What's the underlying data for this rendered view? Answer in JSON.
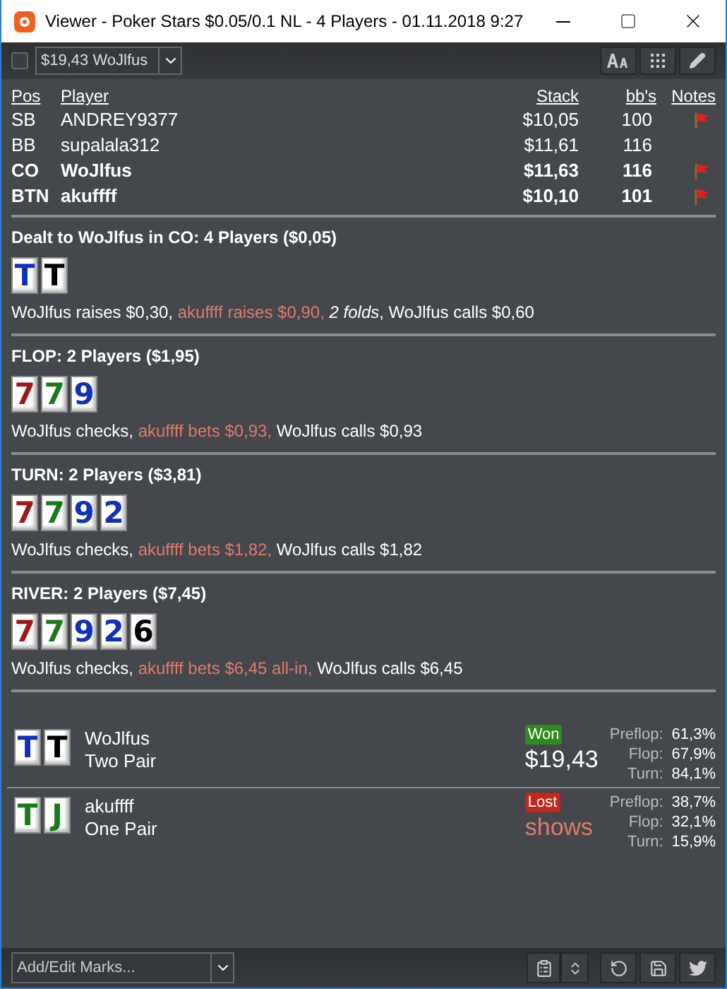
{
  "window": {
    "title": "Viewer - Poker Stars $0.05/0.1 NL - 4 Players - 01.11.2018 9:27"
  },
  "toolbar": {
    "checked": false,
    "hand_select": "$19,43 WoJlfus"
  },
  "players": {
    "columns": [
      "Pos",
      "Player",
      "Stack",
      "bb's",
      "Notes"
    ],
    "rows": [
      {
        "pos": "SB",
        "player": "ANDREY9377",
        "stack": "$10,05",
        "bbs": "100",
        "bold": false,
        "note": true
      },
      {
        "pos": "BB",
        "player": "supalala312",
        "stack": "$11,61",
        "bbs": "116",
        "bold": false,
        "note": false
      },
      {
        "pos": "CO",
        "player": "WoJlfus",
        "stack": "$11,63",
        "bbs": "116",
        "bold": true,
        "note": true
      },
      {
        "pos": "BTN",
        "player": "akuffff",
        "stack": "$10,10",
        "bbs": "101",
        "bold": true,
        "note": true
      }
    ]
  },
  "streets": [
    {
      "title": "Dealt to WoJlfus in CO: 4 Players ($0,05)",
      "cards": [
        {
          "rank": "T",
          "color": "#1030b8"
        },
        {
          "rank": "T",
          "color": "#000000"
        }
      ],
      "actions": [
        {
          "text": "WoJlfus raises $0,30, ",
          "kind": "hero"
        },
        {
          "text": "akuffff raises $0,90, ",
          "kind": "villain"
        },
        {
          "text": "2 folds",
          "kind": "fold"
        },
        {
          "text": ", WoJlfus calls $0,60",
          "kind": "hero"
        }
      ]
    },
    {
      "title": "FLOP: 2 Players ($1,95)",
      "cards": [
        {
          "rank": "7",
          "color": "#a01818"
        },
        {
          "rank": "7",
          "color": "#1a7a1a"
        },
        {
          "rank": "9",
          "color": "#1030b8"
        }
      ],
      "actions": [
        {
          "text": "WoJlfus checks, ",
          "kind": "hero"
        },
        {
          "text": "akuffff bets $0,93, ",
          "kind": "villain"
        },
        {
          "text": "WoJlfus calls $0,93",
          "kind": "hero"
        }
      ]
    },
    {
      "title": "TURN: 2 Players ($3,81)",
      "cards": [
        {
          "rank": "7",
          "color": "#a01818"
        },
        {
          "rank": "7",
          "color": "#1a7a1a"
        },
        {
          "rank": "9",
          "color": "#1030b8"
        },
        {
          "rank": "2",
          "color": "#1030b8"
        }
      ],
      "actions": [
        {
          "text": "WoJlfus checks, ",
          "kind": "hero"
        },
        {
          "text": "akuffff bets $1,82, ",
          "kind": "villain"
        },
        {
          "text": "WoJlfus calls $1,82",
          "kind": "hero"
        }
      ]
    },
    {
      "title": "RIVER: 2 Players ($7,45)",
      "cards": [
        {
          "rank": "7",
          "color": "#a01818"
        },
        {
          "rank": "7",
          "color": "#1a7a1a"
        },
        {
          "rank": "9",
          "color": "#1030b8"
        },
        {
          "rank": "2",
          "color": "#1030b8"
        },
        {
          "rank": "6",
          "color": "#000000"
        }
      ],
      "actions": [
        {
          "text": "WoJlfus checks, ",
          "kind": "hero"
        },
        {
          "text": "akuffff bets $6,45 all-in, ",
          "kind": "villain"
        },
        {
          "text": "WoJlfus calls $6,45",
          "kind": "hero"
        }
      ]
    }
  ],
  "results": [
    {
      "cards": [
        {
          "rank": "T",
          "color": "#1030b8"
        },
        {
          "rank": "T",
          "color": "#000000"
        }
      ],
      "name": "WoJlfus",
      "hand": "Two Pair",
      "outcome": {
        "label": "Won",
        "kind": "won"
      },
      "amount": "$19,43",
      "equity": [
        {
          "label": "Preflop:",
          "value": "61,3%"
        },
        {
          "label": "Flop:",
          "value": "67,9%"
        },
        {
          "label": "Turn:",
          "value": "84,1%"
        }
      ]
    },
    {
      "cards": [
        {
          "rank": "T",
          "color": "#1a7a1a"
        },
        {
          "rank": "J",
          "color": "#1a7a1a"
        }
      ],
      "name": "akuffff",
      "hand": "One Pair",
      "outcome": {
        "label": "Lost",
        "kind": "lost"
      },
      "amount": "shows",
      "equity": [
        {
          "label": "Preflop:",
          "value": "38,7%"
        },
        {
          "label": "Flop:",
          "value": "32,1%"
        },
        {
          "label": "Turn:",
          "value": "15,9%"
        }
      ]
    }
  ],
  "footer": {
    "marks_placeholder": "Add/Edit Marks..."
  }
}
